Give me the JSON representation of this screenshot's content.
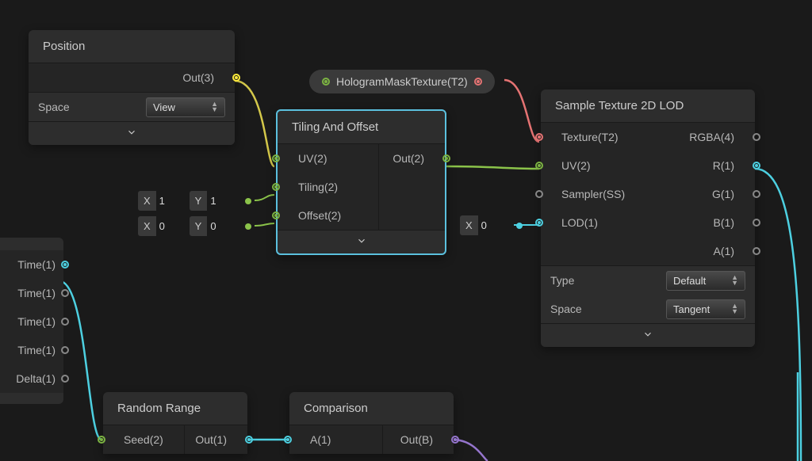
{
  "nodes": {
    "position": {
      "title": "Position",
      "out": "Out(3)",
      "spaceLabel": "Space",
      "spaceValue": "View"
    },
    "tiling": {
      "title": "Tiling And Offset",
      "uv": "UV(2)",
      "tiling": "Tiling(2)",
      "offset": "Offset(2)",
      "out": "Out(2)"
    },
    "sample": {
      "title": "Sample Texture 2D LOD",
      "texture": "Texture(T2)",
      "uv": "UV(2)",
      "sampler": "Sampler(SS)",
      "lod": "LOD(1)",
      "rgba": "RGBA(4)",
      "r": "R(1)",
      "g": "G(1)",
      "b": "B(1)",
      "a": "A(1)",
      "typeLabel": "Type",
      "typeValue": "Default",
      "spaceLabel": "Space",
      "spaceValue": "Tangent"
    },
    "random": {
      "title": "Random Range",
      "seed": "Seed(2)",
      "out": "Out(1)"
    },
    "comparison": {
      "title": "Comparison",
      "a": "A(1)",
      "out": "Out(B)"
    },
    "time": {
      "p0": "Time(1)",
      "p1": "Time(1)",
      "p2": "Time(1)",
      "p3": "Time(1)",
      "p4": "Delta(1)"
    }
  },
  "pill": {
    "label": "HologramMaskTexture(T2)"
  },
  "inlineTiling": {
    "x": "X",
    "xv": "1",
    "y": "Y",
    "yv": "1"
  },
  "inlineOffset": {
    "x": "X",
    "xv": "0",
    "y": "Y",
    "yv": "0"
  },
  "inlineLod": {
    "x": "X",
    "xv": "0"
  },
  "colors": {
    "cyan": "#4dd0e1",
    "green": "#8bc34a",
    "yellow": "#d4c84a",
    "red": "#e57373",
    "purple": "#9575cd"
  }
}
